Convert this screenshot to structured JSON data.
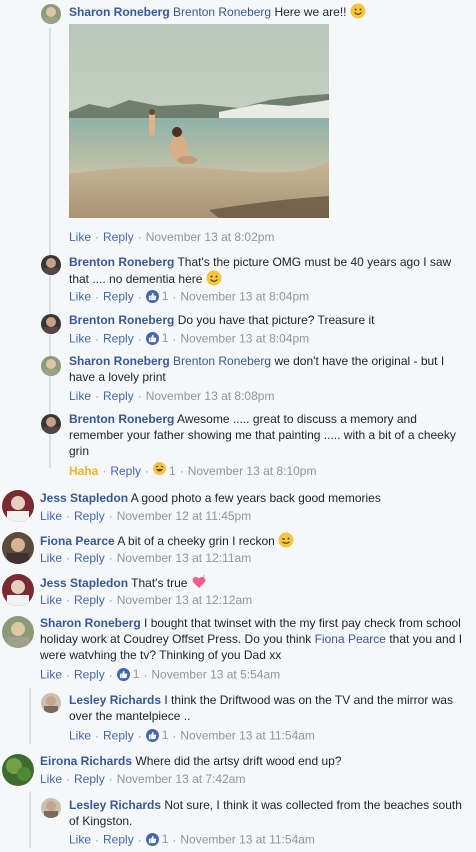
{
  "comments": [
    {
      "name": "Sharon Roneberg",
      "tag": "Brenton Roneberg",
      "text": "Here we are!!",
      "like": "Like",
      "reply": "Reply",
      "time": "November 13 at 8:02pm"
    },
    {
      "name": "Brenton Roneberg",
      "text": "That's the picture OMG must be 40 years ago I saw that .... no dementia here",
      "like": "Like",
      "reply": "Reply",
      "reactions": "1",
      "time": "November 13 at 8:04pm"
    },
    {
      "name": "Brenton Roneberg",
      "text": "Do you have that picture? Treasure it",
      "like": "Like",
      "reply": "Reply",
      "reactions": "1",
      "time": "November 13 at 8:04pm"
    },
    {
      "name": "Sharon Roneberg",
      "tag": "Brenton Roneberg",
      "text": "we don't have the original - but I have a lovely print",
      "like": "Like",
      "reply": "Reply",
      "time": "November 13 at 8:08pm"
    },
    {
      "name": "Brenton Roneberg",
      "text": "Awesome ..... great to discuss a memory and remember your father showing me that painting ..... with a bit of a cheeky grin",
      "like": "Haha",
      "reply": "Reply",
      "reactions": "1",
      "time": "November 13 at 8:10pm"
    },
    {
      "name": "Jess Stapledon",
      "text": "A good photo a few years back good memories",
      "like": "Like",
      "reply": "Reply",
      "time": "November 12 at 11:45pm"
    },
    {
      "name": "Fiona Pearce",
      "text": "A bit of a cheeky grin I reckon",
      "like": "Like",
      "reply": "Reply",
      "time": "November 13 at 12:11am"
    },
    {
      "name": "Jess Stapledon",
      "text": "That's true",
      "like": "Like",
      "reply": "Reply",
      "time": "November 13 at 12:12am"
    },
    {
      "name": "Sharon Roneberg",
      "text_a": "I bought that twinset with the my first pay check from school holiday work at Coudrey Offset Press. Do you think",
      "tag": "Fiona Pearce",
      "text_b": "that you and I were watvhing the tv? Thinking of you Dad xx",
      "like": "Like",
      "reply": "Reply",
      "reactions": "1",
      "time": "November 13 at 5:54am"
    },
    {
      "name": "Lesley Richards",
      "text": "I think the Driftwood was on the TV and the mirror was over the mantelpiece ..",
      "like": "Like",
      "reply": "Reply",
      "reactions": "1",
      "time": "November 13 at 11:54am"
    },
    {
      "name": "Eirona Richards",
      "text": "Where did the artsy drift wood end up?",
      "like": "Like",
      "reply": "Reply",
      "time": "November 13 at 7:42am"
    },
    {
      "name": "Lesley Richards",
      "text": "Not sure, I think it was collected from the beaches south of Kingston.",
      "like": "Like",
      "reply": "Reply",
      "reactions": "1",
      "time": "November 13 at 11:54am"
    }
  ],
  "icons": {
    "like": "thumbs-up-icon",
    "smile": "smile-emoji",
    "wink": "wink-emoji",
    "laugh": "laughing-emoji",
    "heart": "sparkling-heart-emoji"
  },
  "colors": {
    "link": "#365899",
    "action": "#4267b2",
    "meta": "#90949c",
    "haha": "#f7b125",
    "bg": "#f6f7f9"
  }
}
